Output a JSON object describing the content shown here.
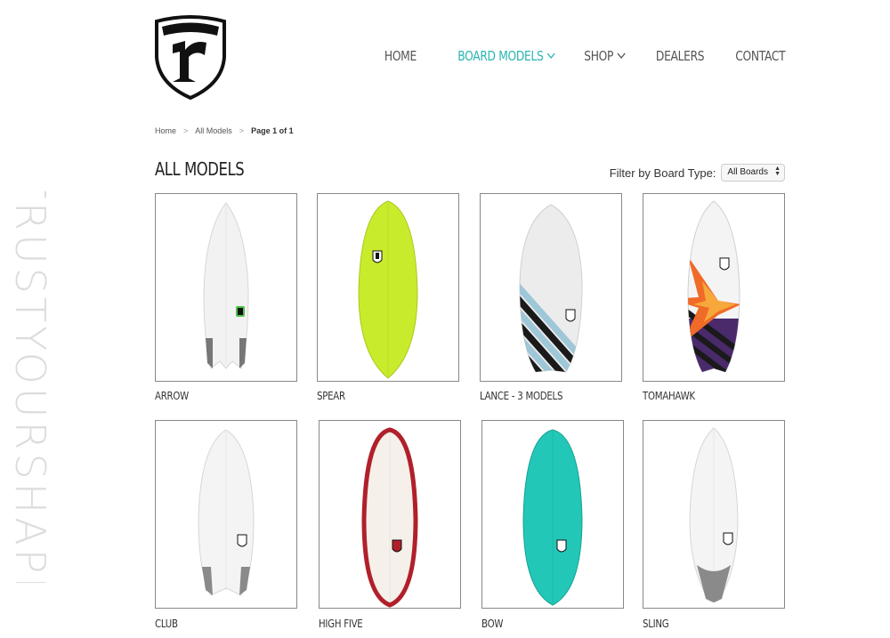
{
  "side_tagline": "#TRUSTYOURSHAPER",
  "logo": {
    "text": "r"
  },
  "nav": {
    "items": [
      {
        "label": "HOME",
        "active": false,
        "dropdown": false
      },
      {
        "label": "BOARD MODELS",
        "active": true,
        "dropdown": true
      },
      {
        "label": "SHOP",
        "active": false,
        "dropdown": true
      },
      {
        "label": "DEALERS",
        "active": false,
        "dropdown": false
      },
      {
        "label": "CONTACT",
        "active": false,
        "dropdown": false
      }
    ]
  },
  "breadcrumb": {
    "home": "Home",
    "sep": ">",
    "section": "All Models",
    "current": "Page 1 of 1"
  },
  "page": {
    "title": "ALL MODELS"
  },
  "filter": {
    "label": "Filter by Board Type:",
    "selected": "All Boards"
  },
  "products": [
    {
      "name": "ARROW",
      "board": "white-green-logo"
    },
    {
      "name": "SPEAR",
      "board": "lime"
    },
    {
      "name": "LANCE - 3 MODELS",
      "board": "stripes-blue"
    },
    {
      "name": "TOMAHAWK",
      "board": "burst-purple"
    },
    {
      "name": "CLUB",
      "board": "white-grey-tail"
    },
    {
      "name": "HIGH FIVE",
      "board": "red-rail"
    },
    {
      "name": "BOW",
      "board": "teal"
    },
    {
      "name": "SLING",
      "board": "white-grey-tip"
    }
  ],
  "colors": {
    "accent": "#2bb5b3",
    "lime": "#c8ec2c",
    "teal": "#22c7b7",
    "red": "#b0202b",
    "purple": "#4a2a6b"
  }
}
